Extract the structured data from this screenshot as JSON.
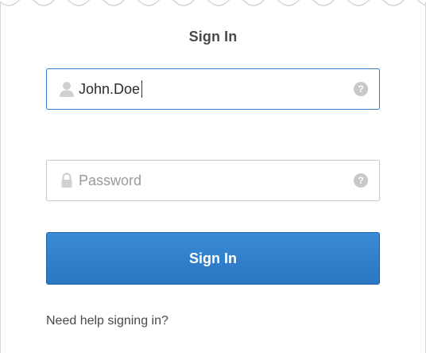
{
  "form": {
    "title": "Sign In",
    "username": {
      "value": "John.Doe"
    },
    "password": {
      "placeholder": "Password",
      "value": ""
    },
    "help_icon_glyph": "?",
    "submit_label": "Sign In",
    "help_link": "Need help signing in?"
  },
  "icons": {
    "username": "user-icon",
    "password": "lock-icon",
    "help": "question-mark-icon"
  },
  "colors": {
    "accent": "#2f78c4",
    "button": "#2a76c2",
    "text": "#4a4a4a",
    "icon_muted": "#c8c8c8"
  }
}
